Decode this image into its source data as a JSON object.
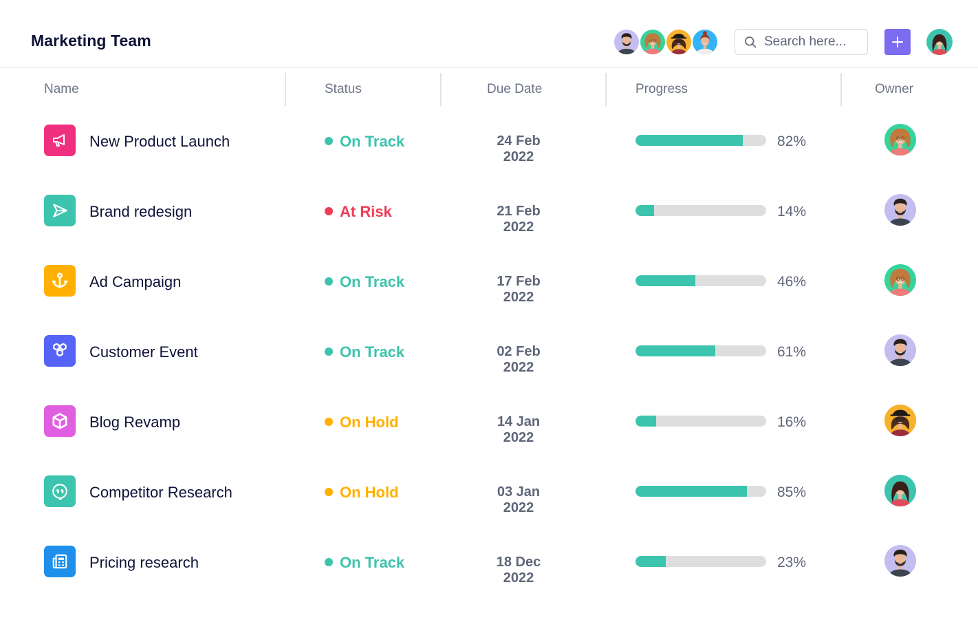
{
  "header": {
    "title": "Marketing Team",
    "team_members": [
      {
        "name": "man-beard",
        "bg": "#c3bdf0"
      },
      {
        "name": "woman-curly",
        "bg": "#36d39a"
      },
      {
        "name": "woman-hat",
        "bg": "#f7b12a"
      },
      {
        "name": "woman-bun",
        "bg": "#35b4f5"
      }
    ],
    "search": {
      "placeholder": "Search here...",
      "value": ""
    },
    "add_button_label": "+",
    "current_user": {
      "name": "woman-longhair",
      "bg": "#3cc4ae"
    }
  },
  "table": {
    "columns": [
      "Name",
      "Status",
      "Due Date",
      "Progress",
      "Owner"
    ],
    "rows": [
      {
        "name": "New Product Launch",
        "icon": "megaphone-icon",
        "icon_bg": "#ef2f7f",
        "status": "On Track",
        "status_color": "#3cc4ae",
        "due": "24 Feb 2022",
        "progress": 82,
        "progress_label": "82%",
        "owner": "woman-curly",
        "owner_bg": "#36d39a"
      },
      {
        "name": "Brand redesign",
        "icon": "send-icon",
        "icon_bg": "#3cc4ae",
        "status": "At Risk",
        "status_color": "#f03c55",
        "due": "21 Feb 2022",
        "progress": 14,
        "progress_label": "14%",
        "owner": "man-beard",
        "owner_bg": "#c3bdf0"
      },
      {
        "name": "Ad Campaign",
        "icon": "anchor-icon",
        "icon_bg": "#ffb000",
        "status": "On Track",
        "status_color": "#3cc4ae",
        "due": "17 Feb 2022",
        "progress": 46,
        "progress_label": "46%",
        "owner": "woman-curly",
        "owner_bg": "#36d39a"
      },
      {
        "name": "Customer Event",
        "icon": "hexagons-icon",
        "icon_bg": "#5563f7",
        "status": "On Track",
        "status_color": "#3cc4ae",
        "due": "02 Feb 2022",
        "progress": 61,
        "progress_label": "61%",
        "owner": "man-beard",
        "owner_bg": "#c3bdf0"
      },
      {
        "name": "Blog Revamp",
        "icon": "cube-icon",
        "icon_bg": "#e05fe0",
        "status": "On Hold",
        "status_color": "#ffb000",
        "due": "14 Jan 2022",
        "progress": 16,
        "progress_label": "16%",
        "owner": "woman-hat",
        "owner_bg": "#f7b12a"
      },
      {
        "name": "Competitor Research",
        "icon": "quote-bubble-icon",
        "icon_bg": "#3cc4ae",
        "status": "On Hold",
        "status_color": "#ffb000",
        "due": "03 Jan 2022",
        "progress": 85,
        "progress_label": "85%",
        "owner": "woman-longhair",
        "owner_bg": "#3cc4ae"
      },
      {
        "name": "Pricing research",
        "icon": "newspaper-icon",
        "icon_bg": "#1e90ec",
        "status": "On Track",
        "status_color": "#3cc4ae",
        "due": "18 Dec 2022",
        "progress": 23,
        "progress_label": "23%",
        "owner": "man-beard",
        "owner_bg": "#c3bdf0"
      }
    ]
  }
}
